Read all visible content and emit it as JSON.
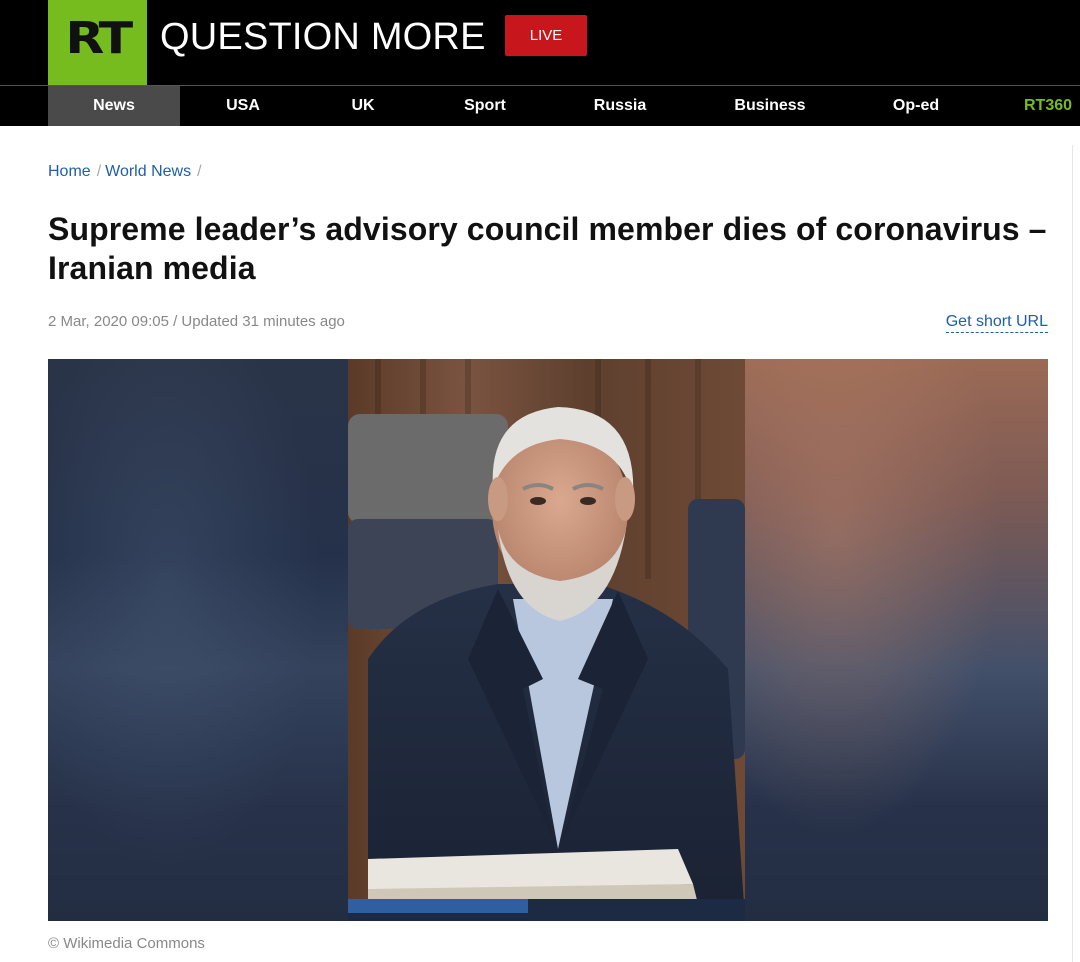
{
  "header": {
    "logo_text": "RT",
    "tagline": "QUESTION MORE",
    "live_label": "LIVE"
  },
  "nav": {
    "items": [
      {
        "label": "News",
        "active": true
      },
      {
        "label": "USA"
      },
      {
        "label": "UK"
      },
      {
        "label": "Sport"
      },
      {
        "label": "Russia"
      },
      {
        "label": "Business"
      },
      {
        "label": "Op-ed"
      },
      {
        "label": "RT360"
      }
    ]
  },
  "breadcrumb": {
    "home": "Home",
    "section": "World News"
  },
  "article": {
    "title_line1": "Supreme leader’s advisory council member dies of coronavirus –",
    "title_line2": "Iranian media",
    "meta": "2 Mar, 2020 09:05 / Updated 31 minutes ago",
    "short_url_label": "Get short URL",
    "photo_caption": "© Wikimedia Commons"
  },
  "colors": {
    "brand_green": "#77bc1f",
    "live_red": "#c7161c",
    "link_blue": "#1f5ea8"
  }
}
